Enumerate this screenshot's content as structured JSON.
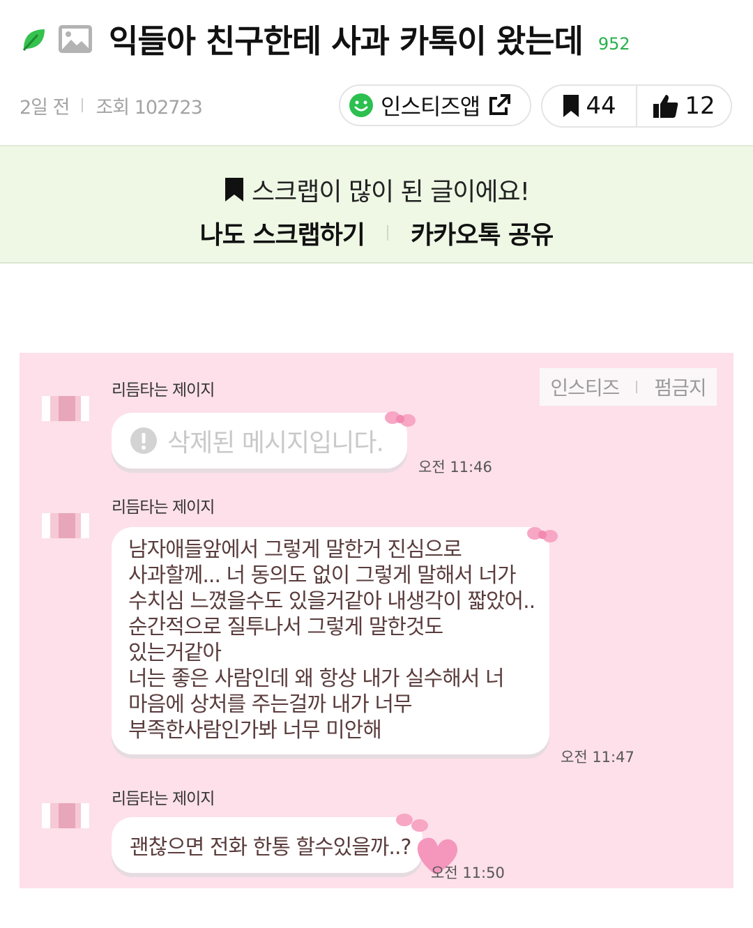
{
  "post": {
    "title": "익들아 친구한테 사과 카톡이 왔는데",
    "comment_count": "952",
    "time_ago": "2일 전",
    "views": "조회 102723",
    "app_button": "인스티즈앱",
    "scrap_count": "44",
    "like_count": "12"
  },
  "banner": {
    "message": "스크랩이 많이 된 글이에요!",
    "scrap_action": "나도 스크랩하기",
    "share_action": "카카오톡 공유"
  },
  "chat": {
    "watermark": {
      "site": "인스티즈",
      "no_repost": "펌금지"
    },
    "messages": [
      {
        "sender": "리듬타는 제이지",
        "text": "삭제된 메시지입니다.",
        "time": "오전 11:46",
        "deleted": true
      },
      {
        "sender": "리듬타는 제이지",
        "lines": [
          "남자애들앞에서 그렇게 말한거 진심으로",
          "사과할께... 너 동의도 없이 그렇게 말해서 너가",
          "수치심 느꼈을수도 있을거같아 내생각이 짧았어..",
          "순간적으로 질투나서 그렇게 말한것도",
          "있는거같아",
          "너는 좋은 사람인데 왜 항상 내가 실수해서 너",
          "마음에 상처를 주는걸까 내가 너무",
          "부족한사람인가봐 너무 미안해"
        ],
        "time": "오전 11:47"
      },
      {
        "sender": "리듬타는 제이지",
        "text": "괜찮으면 전화 한통 할수있을까..?",
        "time": "오전 11:50"
      }
    ]
  },
  "colors": {
    "accent_green": "#27b14b",
    "banner_bg": "#eef8e5",
    "chat_bg": "#fde0e9",
    "bow_pink": "#f7a6c4"
  }
}
